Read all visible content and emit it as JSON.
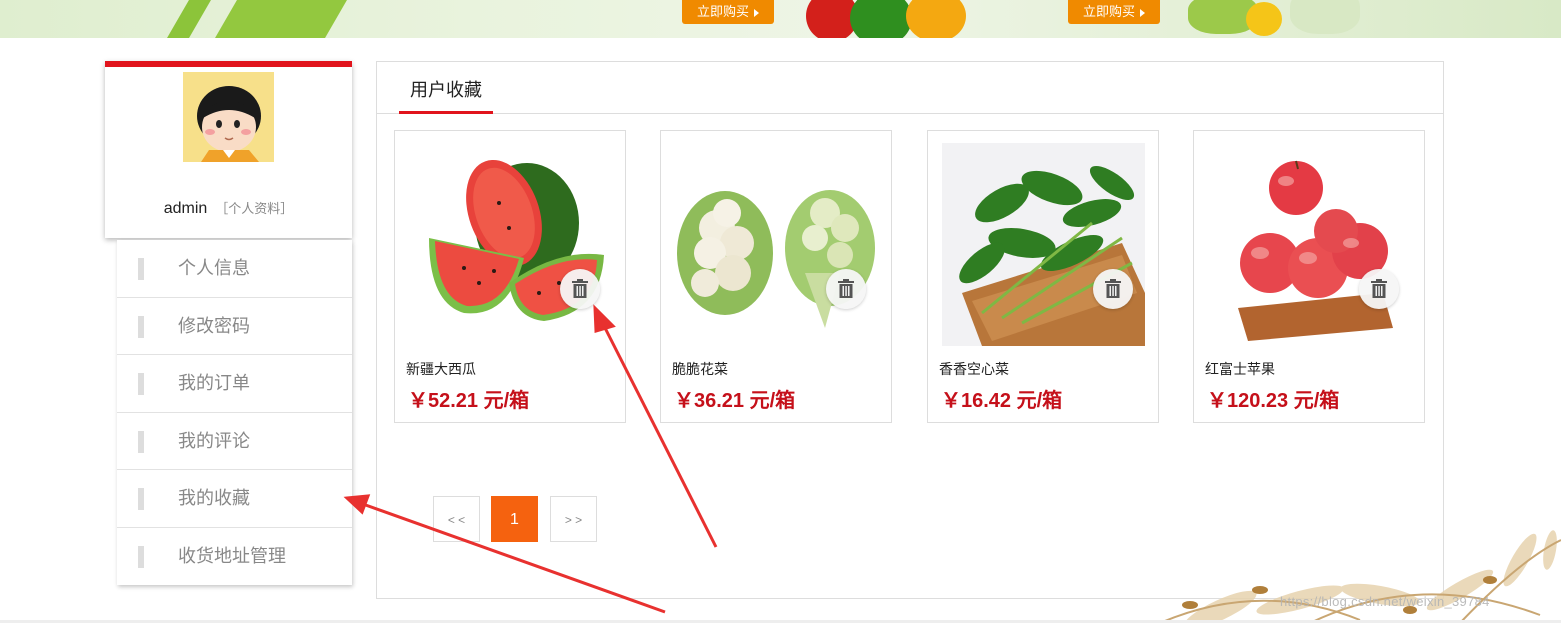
{
  "banner": {
    "buy_label_1": "立即购买",
    "buy_label_2": "立即购买"
  },
  "profile": {
    "username": "admin",
    "profile_link": "［个人资料］"
  },
  "menu": {
    "items": [
      {
        "label": "个人信息"
      },
      {
        "label": "修改密码"
      },
      {
        "label": "我的订单"
      },
      {
        "label": "我的评论"
      },
      {
        "label": "我的收藏"
      },
      {
        "label": "收货地址管理"
      }
    ]
  },
  "panel": {
    "tab": "用户收藏"
  },
  "favorites": [
    {
      "name": "新疆大西瓜",
      "price": "￥52.21 元/箱"
    },
    {
      "name": "脆脆花菜",
      "price": "￥36.21 元/箱"
    },
    {
      "name": "香香空心菜",
      "price": "￥16.42 元/箱"
    },
    {
      "name": "红富士苹果",
      "price": "￥120.23 元/箱"
    }
  ],
  "pagination": {
    "prev": "< <",
    "current": "1",
    "next": "> >"
  },
  "watermark": "https://blog.csdn.net/weixin_39784"
}
